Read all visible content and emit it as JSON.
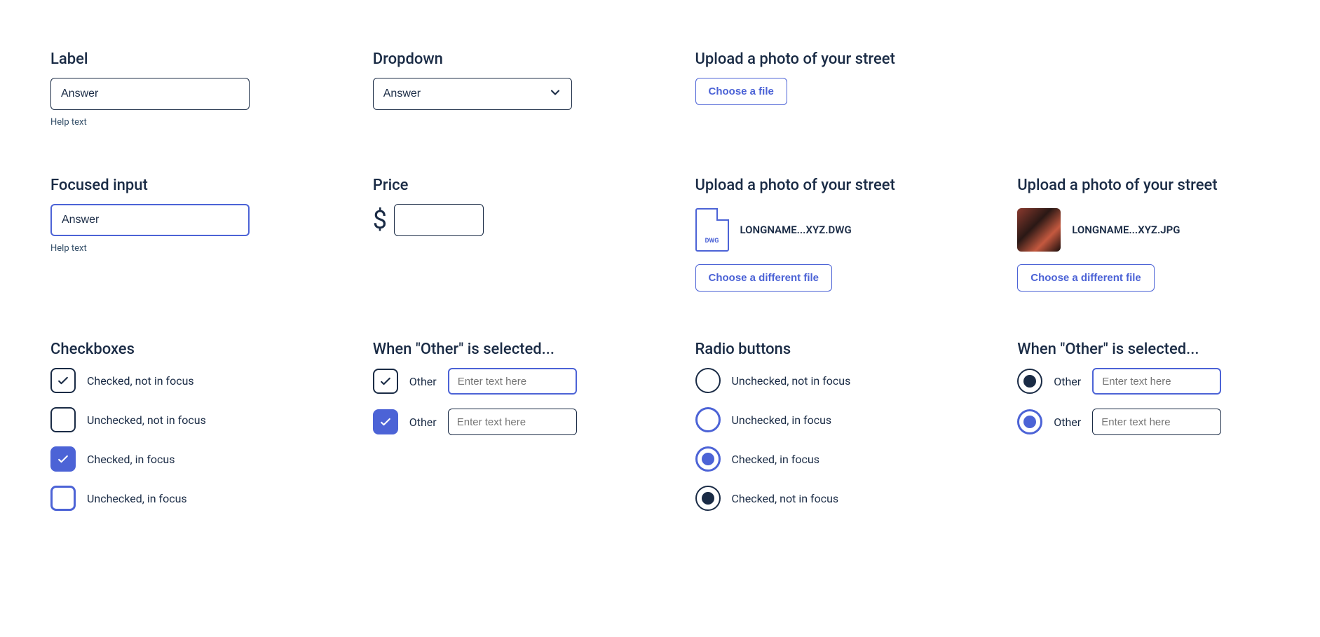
{
  "row1": {
    "text_input": {
      "label": "Label",
      "value": "Answer",
      "help": "Help text"
    },
    "dropdown": {
      "label": "Dropdown",
      "value": "Answer"
    },
    "upload_a": {
      "label": "Upload a photo of your street",
      "button": "Choose a file"
    }
  },
  "row2": {
    "focused": {
      "label": "Focused input",
      "value": "Answer",
      "help": "Help text"
    },
    "price": {
      "label": "Price",
      "symbol": "$"
    },
    "upload_dwg": {
      "label": "Upload a photo of your street",
      "file_ext": "DWG",
      "file_name": "LONGNAME...XYZ.DWG",
      "button": "Choose a different file"
    },
    "upload_jpg": {
      "label": "Upload a photo of your street",
      "file_name": "LONGNAME...XYZ.JPG",
      "button": "Choose a different file"
    }
  },
  "row3": {
    "checkboxes": {
      "label": "Checkboxes",
      "items": [
        "Checked, not in focus",
        "Unchecked, not in focus",
        "Checked, in focus",
        "Unchecked, in focus"
      ]
    },
    "cb_other": {
      "label": "When \"Other\" is selected...",
      "option": "Other",
      "placeholder": "Enter text here"
    },
    "radios": {
      "label": "Radio buttons",
      "items": [
        "Unchecked, not in focus",
        "Unchecked, in focus",
        "Checked, in focus",
        "Checked, not in focus"
      ]
    },
    "rb_other": {
      "label": "When \"Other\" is selected...",
      "option": "Other",
      "placeholder": "Enter text here"
    }
  }
}
